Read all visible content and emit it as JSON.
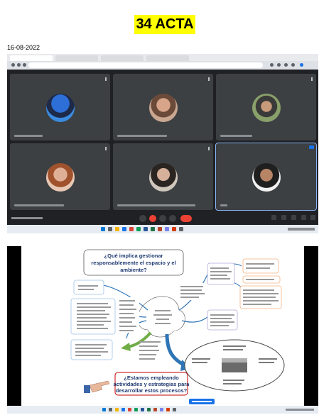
{
  "document": {
    "title": "34 ACTA",
    "date": "16-08-2022"
  },
  "mindmap": {
    "question_top_line1": "¿Qué implica gestionar",
    "question_top_line2": "responsablemente el espacio y el",
    "question_top_line3": "ambiente?",
    "question_bottom_line1": "¿Estamos empleando",
    "question_bottom_line2": "actividades y estrategias para",
    "question_bottom_line3": "desarrollar estos procesos?"
  },
  "colors": {
    "highlight": "#ffff00",
    "meet_bg": "#202124",
    "tile_bg": "#3c4043",
    "end_call": "#ea4335",
    "question_border": "#c00000",
    "arrow_blue": "#2e75b6",
    "arrow_green": "#70ad47"
  }
}
